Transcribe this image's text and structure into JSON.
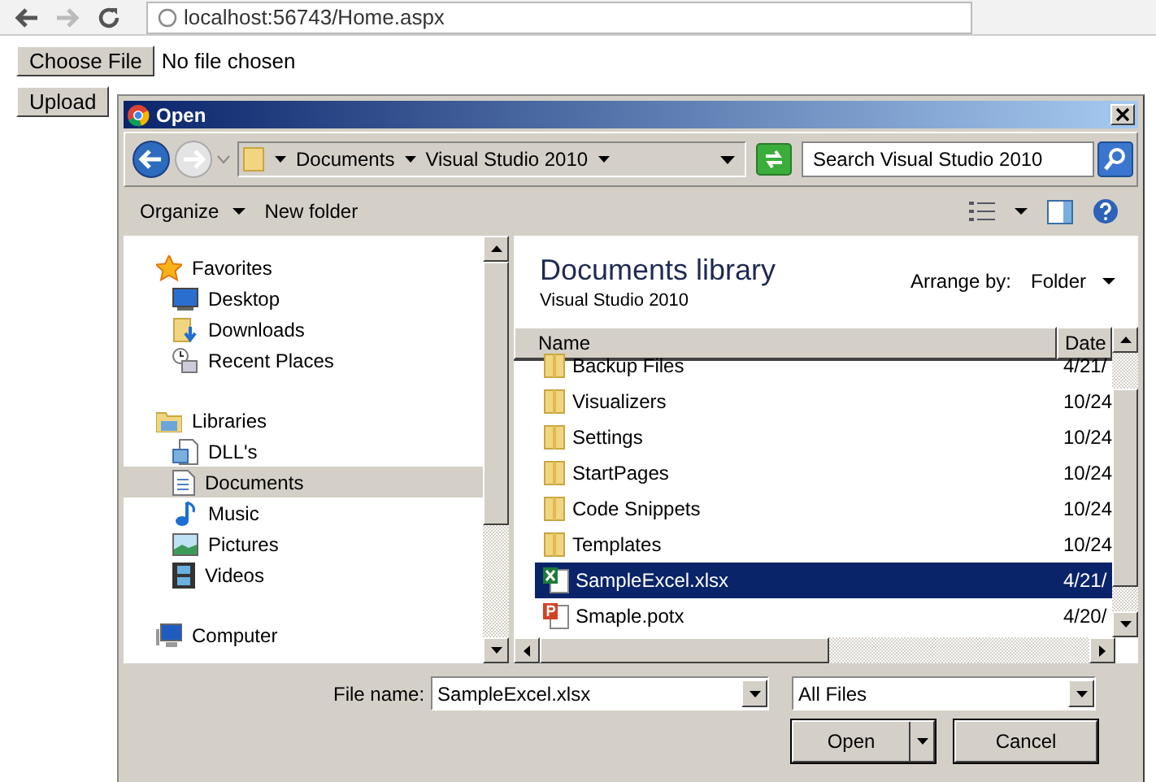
{
  "browser": {
    "address": "localhost:56743/Home.aspx"
  },
  "page": {
    "choose_file_button": "Choose File",
    "file_status": "No file chosen",
    "upload_button": "Upload"
  },
  "dialog": {
    "title": "Open",
    "breadcrumb": [
      "Documents",
      "Visual Studio 2010"
    ],
    "search_placeholder": "Search Visual Studio 2010",
    "toolbar": [
      {
        "label": "Organize",
        "menu": true
      },
      {
        "label": "New folder",
        "menu": false
      }
    ],
    "nav_tree": [
      {
        "label": "Favorites",
        "kind": "star",
        "selected": false,
        "children": [
          {
            "label": "Desktop",
            "kind": "desktop",
            "selected": false
          },
          {
            "label": "Downloads",
            "kind": "downloads",
            "selected": false
          },
          {
            "label": "Recent Places",
            "kind": "recent",
            "selected": false
          }
        ]
      },
      {
        "label": "Libraries",
        "kind": "libraries",
        "selected": false,
        "children": [
          {
            "label": "DLL's",
            "kind": "library",
            "selected": false
          },
          {
            "label": "Documents",
            "kind": "document",
            "selected": true
          },
          {
            "label": "Music",
            "kind": "music",
            "selected": false
          },
          {
            "label": "Pictures",
            "kind": "pictures",
            "selected": false
          },
          {
            "label": "Videos",
            "kind": "videos",
            "selected": false
          }
        ]
      },
      {
        "label": "Computer",
        "kind": "computer",
        "selected": false
      }
    ],
    "library": {
      "title": "Documents library",
      "subtitle": "Visual Studio 2010",
      "arrange_label": "Arrange by:",
      "arrange_value": "Folder"
    },
    "columns": [
      "Name",
      "Date"
    ],
    "files": [
      {
        "name": "Backup Files",
        "date": "4/21/",
        "kind": "folder",
        "selected": false
      },
      {
        "name": "Visualizers",
        "date": "10/24",
        "kind": "folder",
        "selected": false
      },
      {
        "name": "Settings",
        "date": "10/24",
        "kind": "folder",
        "selected": false
      },
      {
        "name": "StartPages",
        "date": "10/24",
        "kind": "folder",
        "selected": false
      },
      {
        "name": "Code Snippets",
        "date": "10/24",
        "kind": "folder",
        "selected": false
      },
      {
        "name": "Templates",
        "date": "10/24",
        "kind": "folder",
        "selected": false
      },
      {
        "name": "SampleExcel.xlsx",
        "date": "4/21/",
        "kind": "excel",
        "selected": true
      },
      {
        "name": "Smaple.potx",
        "date": "4/20/",
        "kind": "powerpoint",
        "selected": false
      }
    ],
    "file_name_label": "File name:",
    "file_name": "SampleExcel.xlsx",
    "file_type": "All Files",
    "open_button": "Open",
    "cancel_button": "Cancel"
  }
}
